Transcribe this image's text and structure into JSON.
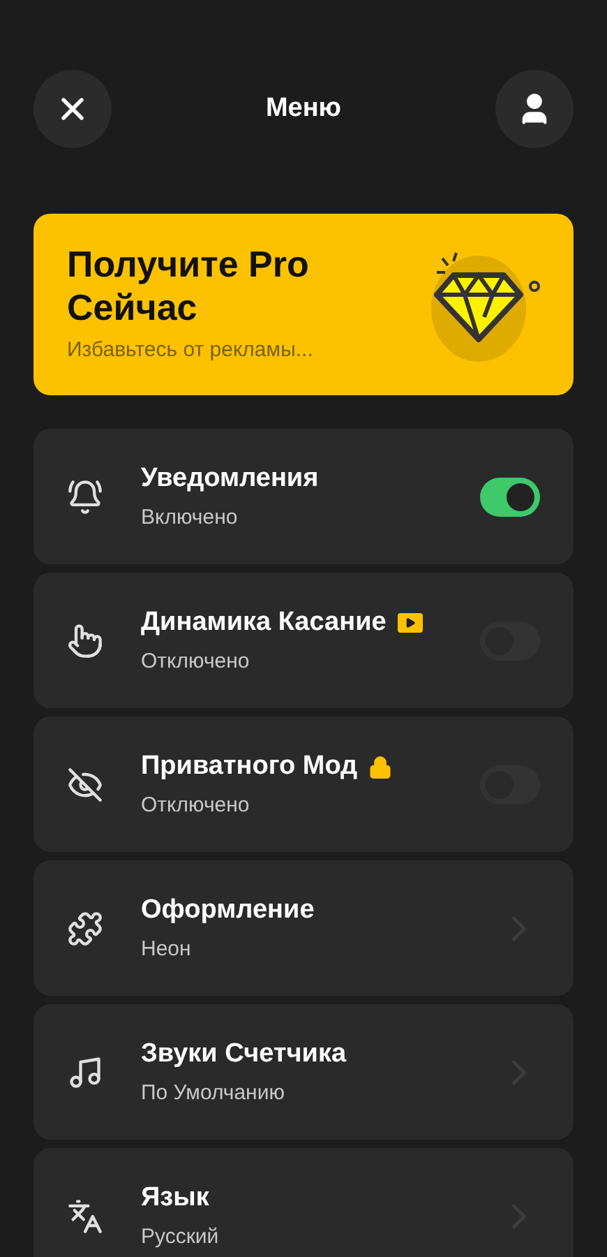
{
  "header": {
    "title": "Меню"
  },
  "promo": {
    "title": "Получите Pro Сейчас",
    "subtitle": "Избавьтесь от рекламы..."
  },
  "items": [
    {
      "kind": "toggle",
      "title": "Уведомления",
      "subtitle": "Включено",
      "on": true
    },
    {
      "kind": "toggle",
      "title": "Динамика Касание",
      "subtitle": "Отключено",
      "on": false,
      "video_badge": true
    },
    {
      "kind": "toggle",
      "title": "Приватного Мод",
      "subtitle": "Отключено",
      "on": false,
      "locked": true
    },
    {
      "kind": "link",
      "title": "Оформление",
      "subtitle": "Неон"
    },
    {
      "kind": "link",
      "title": "Звуки Счетчика",
      "subtitle": "По Умолчанию"
    },
    {
      "kind": "link",
      "title": "Язык",
      "subtitle": "Русский"
    }
  ]
}
